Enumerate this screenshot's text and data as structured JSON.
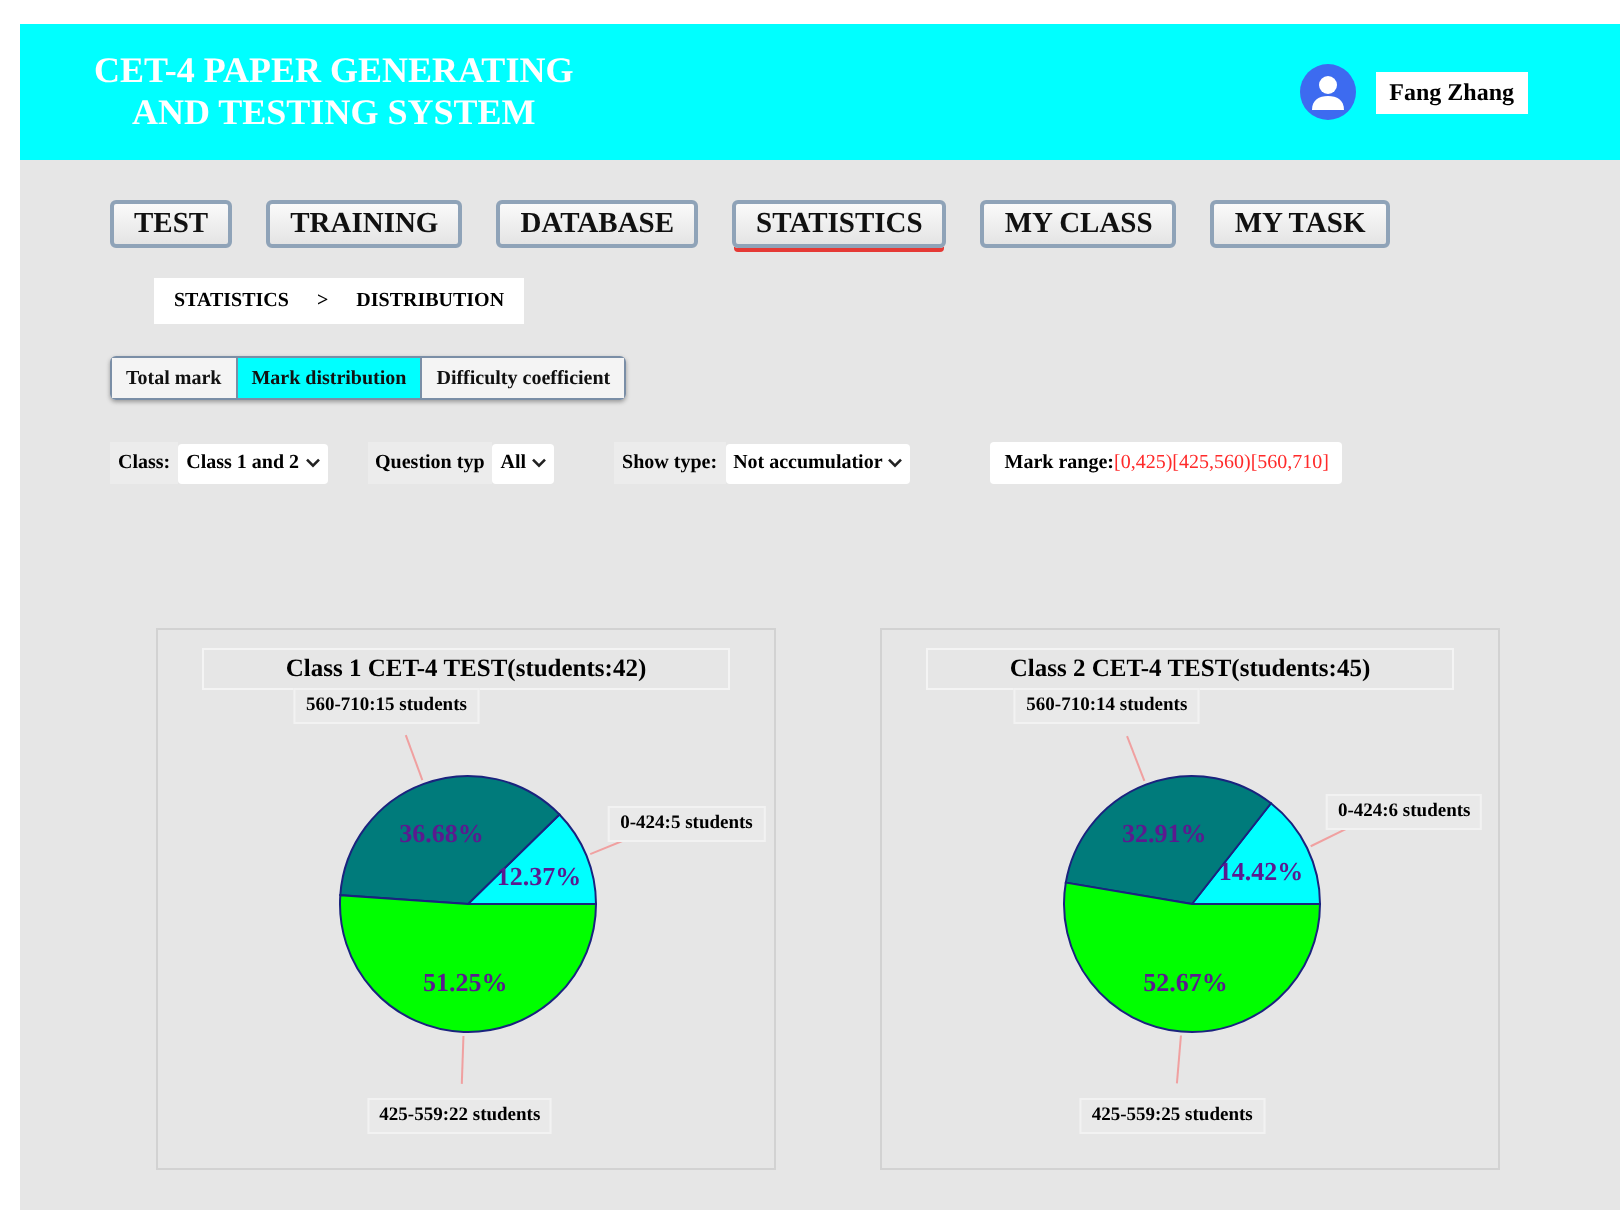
{
  "header": {
    "title_lines": [
      "CET-4 PAPER GENERATING",
      "AND TESTING SYSTEM"
    ],
    "user": "Fang Zhang"
  },
  "nav_tabs": [
    {
      "label": "TEST",
      "selected": false
    },
    {
      "label": "TRAINING",
      "selected": false
    },
    {
      "label": "DATABASE",
      "selected": false
    },
    {
      "label": "STATISTICS",
      "selected": true
    },
    {
      "label": "MY CLASS",
      "selected": false
    },
    {
      "label": "MY TASK",
      "selected": false
    }
  ],
  "breadcrumb": {
    "items": [
      "STATISTICS",
      "DISTRIBUTION"
    ],
    "separator": ">"
  },
  "view_tabs": [
    {
      "label": "Total mark",
      "selected": false
    },
    {
      "label": "Mark distribution",
      "selected": true
    },
    {
      "label": "Difficulty coefficient",
      "selected": false
    }
  ],
  "filters": [
    {
      "kind": "select",
      "label": "Class:",
      "value": "Class 1 and 2"
    },
    {
      "kind": "select",
      "label": "Question typ",
      "value": "All"
    },
    {
      "kind": "select",
      "label": "Show type:",
      "value": "Not accumulatior"
    },
    {
      "kind": "range",
      "label": "Mark range:",
      "value": "[0,425)[425,560)[560,710]"
    }
  ],
  "charts": [
    {
      "title": "Class 1 CET-4 TEST(students:42)",
      "chart_data": {
        "type": "pie",
        "categories": [
          "0-424:5 students",
          "560-710:15 students",
          "425-559:22 students"
        ],
        "values": [
          12.37,
          36.68,
          51.25
        ],
        "colors": [
          "#00ffff",
          "#007b7b",
          "#00ff00"
        ],
        "value_labels": [
          "12.37%",
          "36.68%",
          "51.25%"
        ],
        "data_labels": "value_labels"
      }
    },
    {
      "title": "Class 2 CET-4 TEST(students:45)",
      "chart_data": {
        "type": "pie",
        "categories": [
          "0-424:6 students",
          "560-710:14 students",
          "425-559:25 students"
        ],
        "values": [
          14.42,
          32.91,
          52.67
        ],
        "colors": [
          "#00ffff",
          "#007b7b",
          "#00ff00"
        ],
        "value_labels": [
          "14.42%",
          "32.91%",
          "52.67%"
        ],
        "data_labels": "value_labels"
      }
    }
  ]
}
